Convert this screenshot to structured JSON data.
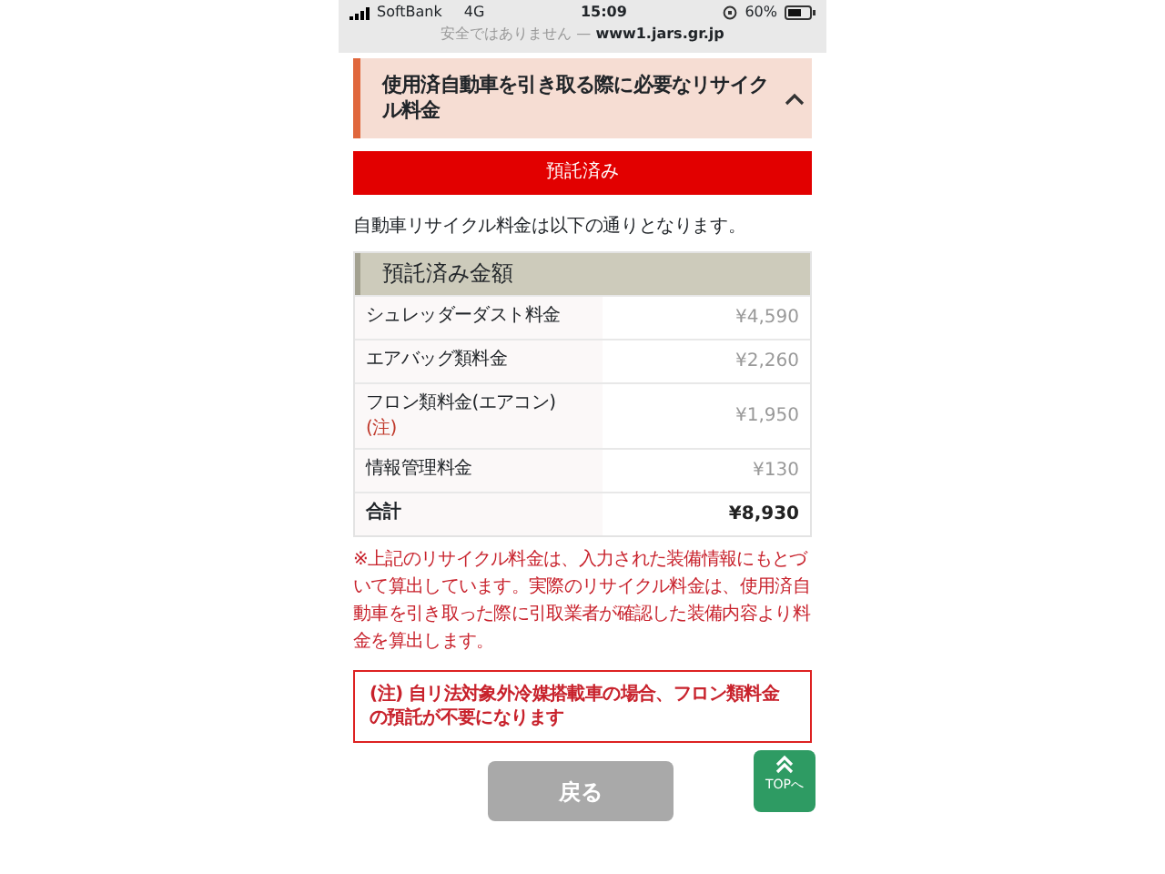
{
  "status_bar": {
    "carrier": "SoftBank",
    "network": "4G",
    "time": "15:09",
    "battery": "60%"
  },
  "address_bar": {
    "security": "安全ではありません — ",
    "domain": "www1.jars.gr.jp"
  },
  "section": {
    "title": "使用済自動車を引き取る際に必要なリサイクル料金",
    "expanded": true
  },
  "status_banner": "預託済み",
  "intro": "自動車リサイクル料金は以下の通りとなります。",
  "table": {
    "header": "預託済み金額",
    "rows": [
      {
        "kind": "item",
        "label": "シュレッダーダスト料金",
        "value": "¥4,590"
      },
      {
        "kind": "item",
        "label": "エアバッグ類料金",
        "value": "¥2,260"
      },
      {
        "kind": "item",
        "label": "フロン類料金(エアコン)",
        "note": "(注)",
        "value": "¥1,950"
      },
      {
        "kind": "item",
        "label": "情報管理料金",
        "value": "¥130"
      },
      {
        "kind": "total",
        "label": "合計",
        "value": "¥8,930"
      }
    ]
  },
  "notice": "※上記のリサイクル料金は、入力された装備情報にもとづいて算出しています。実際のリサイクル料金は、使用済自動車を引き取った際に引取業者が確認した装備内容より料金を算出します。",
  "warning": "(注) 自リ法対象外冷媒搭載車の場合、フロン類料金の預託が不要になります",
  "back_button": "戻る",
  "top_button": "TOPへ"
}
